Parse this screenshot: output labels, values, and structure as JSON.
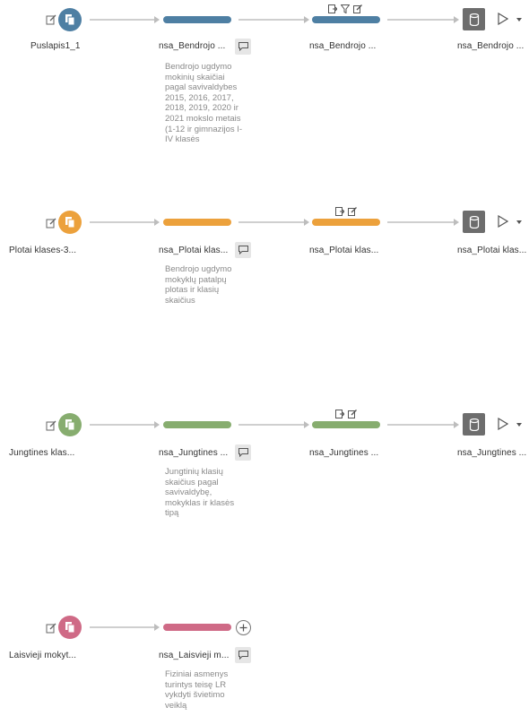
{
  "colors": {
    "blue": "#4e7fa3",
    "orange": "#eca13c",
    "green": "#87ad6f",
    "pink": "#cf6a86",
    "connector": "#cfcfcf",
    "output": "#6d6d6d"
  },
  "flows": [
    {
      "color": "#4e7fa3",
      "input_label": "Puslapis1_1",
      "clean_label": "nsa_Bendrojo ...",
      "description": [
        "Bendrojo ugdymo",
        "mokinių skaičiai",
        "pagal savivaldybes",
        "2015, 2016, 2017,",
        "2018, 2019, 2020 ir",
        "2021 mokslo metais",
        "(1-12 ir gimnazijos I-",
        "IV klasės"
      ],
      "step_label": "nsa_Bendrojo ...",
      "step_tools": [
        "table-icon",
        "filter-icon",
        "pencil-icon"
      ],
      "output_label": "nsa_Bendrojo ..."
    },
    {
      "color": "#eca13c",
      "input_label": "Plotai klases-3...",
      "clean_label": "nsa_Plotai klas...",
      "description": [
        "Bendrojo ugdymo",
        "mokyklų patalpų",
        "plotas ir klasių",
        "skaičius"
      ],
      "step_label": "nsa_Plotai klas...",
      "step_tools": [
        "table-icon",
        "pencil-icon"
      ],
      "output_label": "nsa_Plotai klas..."
    },
    {
      "color": "#87ad6f",
      "input_label": "Jungtines klas...",
      "clean_label": "nsa_Jungtines ...",
      "description": [
        "Jungtinių klasių",
        "skaičius pagal",
        "savivaldybę,",
        "mokyklas ir klasės",
        "tipą"
      ],
      "step_label": "nsa_Jungtines ...",
      "step_tools": [
        "table-icon",
        "pencil-icon"
      ],
      "output_label": "nsa_Jungtines ..."
    },
    {
      "color": "#cf6a86",
      "input_label": "Laisvieji mokyt...",
      "clean_label": "nsa_Laisvieji m...",
      "description": [
        "Fiziniai asmenys",
        "turintys teisę LR",
        "vykdyti švietimo",
        "veiklą"
      ]
    }
  ]
}
